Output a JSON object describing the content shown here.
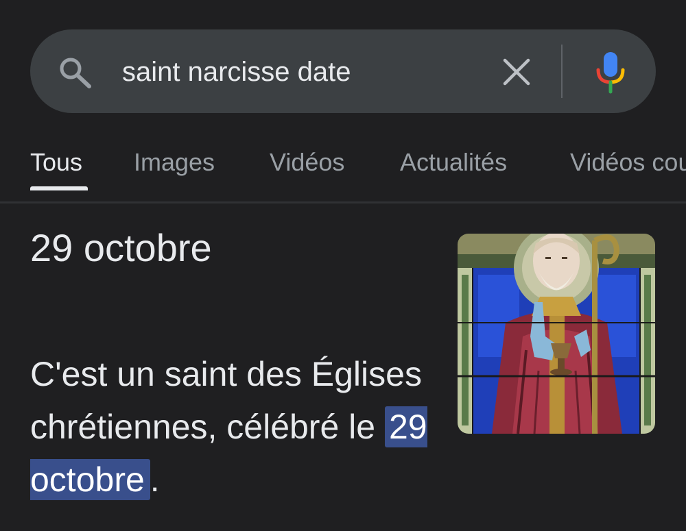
{
  "search": {
    "query": "saint narcisse date",
    "icons": {
      "search": "search-icon",
      "clear": "close-icon",
      "voice": "microphone-icon"
    }
  },
  "tabs": [
    {
      "label": "Tous",
      "active": true
    },
    {
      "label": "Images",
      "active": false
    },
    {
      "label": "Vidéos",
      "active": false
    },
    {
      "label": "Actualités",
      "active": false
    },
    {
      "label": "Vidéos courtes",
      "active": false
    }
  ],
  "answer": {
    "title": "29 octobre",
    "description_before": "C'est un saint des Églises chrétiennes, célébré le ",
    "description_highlight": "29 octobre",
    "description_after": "."
  },
  "thumbnail": {
    "subject": "stained-glass-saint-image"
  },
  "colors": {
    "background": "#1f1f21",
    "search_bar": "#3c4043",
    "highlight": "#394f8c",
    "text_primary": "#e8eaed",
    "text_secondary": "#9aa0a6",
    "mic_blue": "#4285f4",
    "mic_red": "#ea4335",
    "mic_yellow": "#fbbc04",
    "mic_green": "#34a853"
  }
}
